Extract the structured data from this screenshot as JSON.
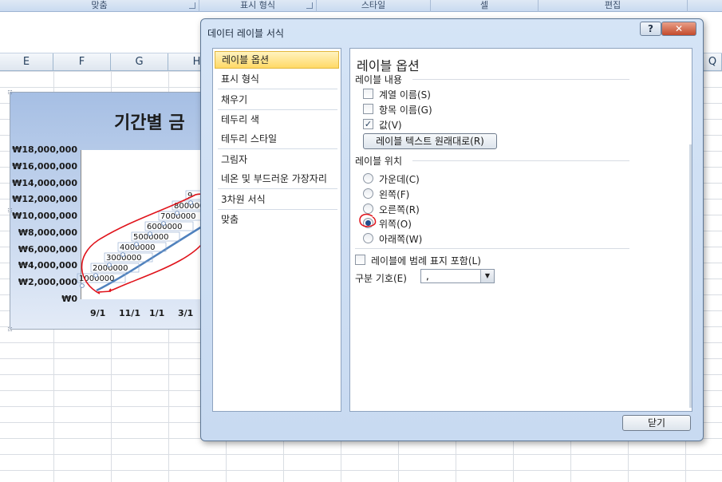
{
  "ribbon": {
    "groups": [
      "맞춤",
      "표시 형식",
      "스타일",
      "셀",
      "편집"
    ]
  },
  "sheet": {
    "columns": [
      "E",
      "F",
      "G",
      "H",
      "Q"
    ]
  },
  "chart": {
    "title": "기간별 금",
    "y_ticks": [
      "₩18,000,000",
      "₩16,000,000",
      "₩14,000,000",
      "₩12,000,000",
      "₩10,000,000",
      "₩8,000,000",
      "₩6,000,000",
      "₩4,000,000",
      "₩2,000,000",
      "₩0"
    ],
    "x_ticks": [
      "9/1",
      "11/1",
      "1/1",
      "3/1"
    ],
    "data_labels": [
      "1000000",
      "2000000",
      "3000000",
      "4000000",
      "5000000",
      "6000000",
      "7000000",
      "8000000",
      "9"
    ],
    "colors": {
      "series_line": "#4f81bd",
      "annotation": "#e0141c"
    }
  },
  "dialog": {
    "title": "데이터 레이블 서식",
    "help_label": "?",
    "close_glyph": "✕",
    "nav": {
      "items": [
        {
          "label": "레이블 옵션",
          "selected": true
        },
        {
          "label": "표시 형식"
        },
        {
          "label": "채우기"
        },
        {
          "label": "테두리 색"
        },
        {
          "label": "테두리 스타일"
        },
        {
          "label": "그림자"
        },
        {
          "label": "네온 및 부드러운 가장자리"
        },
        {
          "label": "3차원 서식"
        },
        {
          "label": "맞춤"
        }
      ]
    },
    "content": {
      "heading": "레이블 옵션",
      "label_contains": {
        "title": "레이블 내용",
        "series_name": "계열 이름(S)",
        "category_name": "항목 이름(G)",
        "value": "값(V)",
        "value_checked": "✓",
        "reset_button": "레이블 텍스트 원래대로(R)"
      },
      "label_position": {
        "title": "레이블 위치",
        "options": [
          "가운데(C)",
          "왼쪽(F)",
          "오른쪽(R)",
          "위쪽(O)",
          "아래쪽(W)"
        ]
      },
      "legend_key": "레이블에 범례 표지 포함(L)",
      "separator": {
        "label": "구분 기호(E)",
        "value": ","
      }
    },
    "close_button": "닫기"
  }
}
